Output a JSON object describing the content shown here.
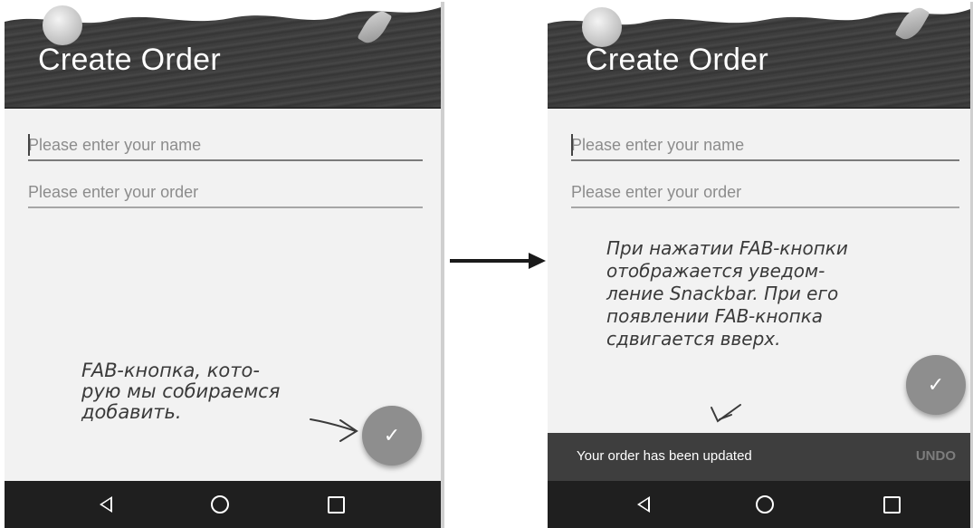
{
  "left_screen": {
    "app_title": "Create Order",
    "name_field": {
      "placeholder": "Please enter your name",
      "value": ""
    },
    "order_field": {
      "placeholder": "Please enter your order",
      "value": ""
    },
    "fab_icon": "checkmark-icon"
  },
  "right_screen": {
    "app_title": "Create Order",
    "name_field": {
      "placeholder": "Please enter your name",
      "value": ""
    },
    "order_field": {
      "placeholder": "Please enter your order",
      "value": ""
    },
    "fab_icon": "checkmark-icon",
    "snackbar": {
      "message": "Your order has been updated",
      "action": "UNDO"
    }
  },
  "annotations": {
    "left_note": [
      "FAB-кнопка, кото-",
      "рую мы собираемся",
      "добавить."
    ],
    "right_note": [
      "При нажатии FAB-кнопки",
      "отображается уведом-",
      "ление Snackbar. При его",
      "появлении FAB-кнопка",
      "сдвигается вверх."
    ]
  },
  "nav_icons": [
    "back-icon",
    "home-icon",
    "recents-icon"
  ]
}
